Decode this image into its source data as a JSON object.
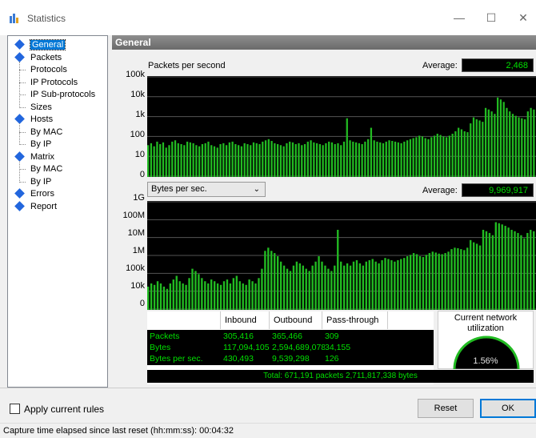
{
  "window": {
    "title": "Statistics",
    "controls": {
      "minimize": "—",
      "maximize": "☐",
      "close": "✕"
    },
    "accent": "#0078d7"
  },
  "tree": [
    {
      "label": "General",
      "level": 0,
      "selected": true
    },
    {
      "label": "Packets",
      "level": 0
    },
    {
      "label": "Protocols",
      "level": 1
    },
    {
      "label": "IP Protocols",
      "level": 1
    },
    {
      "label": "IP Sub-protocols",
      "level": 1
    },
    {
      "label": "Sizes",
      "level": 1
    },
    {
      "label": "Hosts",
      "level": 0
    },
    {
      "label": "By MAC",
      "level": 1
    },
    {
      "label": "By IP",
      "level": 1
    },
    {
      "label": "Matrix",
      "level": 0
    },
    {
      "label": "By MAC",
      "level": 1
    },
    {
      "label": "By IP",
      "level": 1
    },
    {
      "label": "Errors",
      "level": 0
    },
    {
      "label": "Report",
      "level": 0
    }
  ],
  "panel": {
    "header": "General",
    "packets_chart": {
      "title": "Packets per second",
      "average_label": "Average:",
      "average_value": "2,468",
      "yticks": [
        "100k",
        "10k",
        "1k",
        "100",
        "10",
        "0"
      ]
    },
    "bytes_chart": {
      "dropdown_value": "Bytes per sec.",
      "average_label": "Average:",
      "average_value": "9,969,917",
      "yticks": [
        "1G",
        "100M",
        "10M",
        "1M",
        "100k",
        "10k",
        "0"
      ]
    },
    "table": {
      "columns": [
        "",
        "Inbound",
        "Outbound",
        "Pass-through"
      ],
      "rows": [
        {
          "label": "Packets",
          "inbound": "305,416",
          "outbound": "365,466",
          "pass": "309"
        },
        {
          "label": "Bytes",
          "inbound": "117,094,105",
          "outbound": "2,594,689,078",
          "pass": "34,155"
        },
        {
          "label": "Bytes per sec.",
          "inbound": "430,493",
          "outbound": "9,539,298",
          "pass": "126"
        }
      ],
      "total": "Total: 671,191 packets 2,711,817,338 bytes"
    },
    "utilization": {
      "title_line1": "Current network",
      "title_line2": "utilization",
      "value": "1.56%"
    }
  },
  "footer": {
    "apply_rules_label": "Apply current rules",
    "apply_rules_checked": false,
    "reset_label": "Reset",
    "ok_label": "OK",
    "status_text": "Capture time elapsed since last reset (hh:mm:ss): 00:04:32"
  },
  "colors": {
    "plot_bg": "#000000",
    "bar_green": "#22bb22",
    "text_green": "#00e000",
    "header_gray": "#7a7a7a"
  },
  "chart_data": [
    {
      "type": "bar",
      "title": "Packets per second",
      "ylabel": "",
      "yscale": "log",
      "yticks": [
        "0",
        "10",
        "100",
        "1k",
        "10k",
        "100k"
      ],
      "ylim": [
        0,
        100000
      ],
      "profile_note": "",
      "values": [
        40,
        50,
        35,
        60,
        45,
        55,
        30,
        40,
        60,
        70,
        50,
        45,
        40,
        60,
        55,
        50,
        40,
        35,
        45,
        50,
        60,
        40,
        35,
        30,
        45,
        50,
        40,
        55,
        60,
        45,
        40,
        35,
        50,
        45,
        40,
        55,
        50,
        45,
        60,
        70,
        80,
        65,
        50,
        45,
        40,
        35,
        50,
        60,
        55,
        45,
        50,
        40,
        45,
        60,
        70,
        55,
        50,
        45,
        40,
        50,
        60,
        55,
        45,
        50,
        40,
        60,
        900,
        70,
        60,
        55,
        50,
        45,
        60,
        80,
        300,
        70,
        60,
        55,
        50,
        60,
        70,
        65,
        60,
        55,
        50,
        60,
        70,
        80,
        90,
        100,
        120,
        110,
        90,
        80,
        100,
        120,
        150,
        130,
        110,
        100,
        120,
        150,
        200,
        300,
        250,
        200,
        180,
        500,
        1000,
        800,
        700,
        600,
        3000,
        2500,
        2000,
        1500,
        10000,
        8000,
        6000,
        3000,
        2000,
        1500,
        1200,
        1000,
        900,
        800,
        2000,
        3000,
        2500
      ]
    },
    {
      "type": "bar",
      "title": "Bytes per sec.",
      "ylabel": "",
      "yscale": "log",
      "yticks": [
        "0",
        "10k",
        "100k",
        "1M",
        "10M",
        "100M",
        "1G"
      ],
      "ylim": [
        0,
        1000000000
      ],
      "values": [
        20000,
        30000,
        25000,
        40000,
        30000,
        20000,
        15000,
        30000,
        50000,
        80000,
        40000,
        30000,
        25000,
        60000,
        200000,
        150000,
        100000,
        60000,
        40000,
        30000,
        50000,
        40000,
        30000,
        25000,
        40000,
        50000,
        30000,
        60000,
        80000,
        40000,
        30000,
        25000,
        50000,
        40000,
        30000,
        60000,
        200000,
        2000000,
        3000000,
        2000000,
        1500000,
        1000000,
        500000,
        300000,
        200000,
        150000,
        300000,
        500000,
        400000,
        300000,
        200000,
        150000,
        300000,
        500000,
        1000000,
        500000,
        300000,
        200000,
        150000,
        300000,
        30000000,
        500000,
        300000,
        400000,
        300000,
        500000,
        600000,
        400000,
        300000,
        500000,
        600000,
        700000,
        500000,
        400000,
        600000,
        800000,
        700000,
        600000,
        500000,
        600000,
        700000,
        800000,
        1000000,
        1200000,
        1500000,
        1300000,
        1000000,
        900000,
        1200000,
        1500000,
        1800000,
        1600000,
        1400000,
        1300000,
        1500000,
        1800000,
        2500000,
        3000000,
        2800000,
        2500000,
        2200000,
        3000000,
        8000000,
        6000000,
        5000000,
        4000000,
        30000000,
        25000000,
        20000000,
        15000000,
        80000000,
        70000000,
        60000000,
        50000000,
        40000000,
        30000000,
        25000000,
        20000000,
        15000000,
        10000000,
        20000000,
        30000000,
        25000000
      ]
    }
  ]
}
